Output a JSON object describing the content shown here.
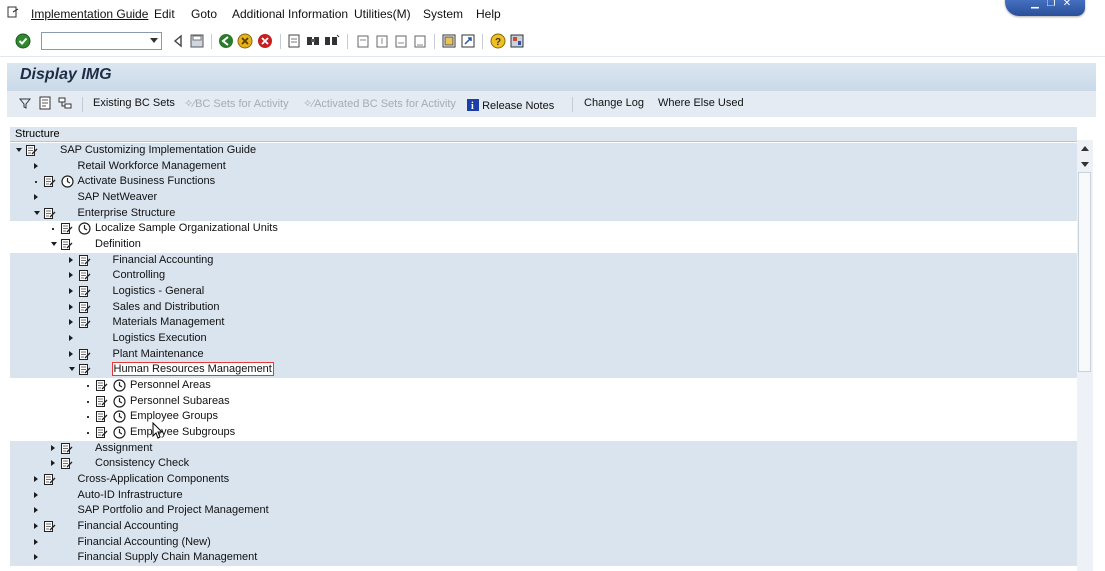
{
  "menu": {
    "items": [
      {
        "label": "Implementation Guide"
      },
      {
        "label": "Edit"
      },
      {
        "label": "Goto"
      },
      {
        "label": "Additional Information"
      },
      {
        "label": "Utilities(M)"
      },
      {
        "label": "System"
      },
      {
        "label": "Help"
      }
    ]
  },
  "toolbar": {
    "command_value": "",
    "icons": [
      "enter-icon",
      "back-triangle-icon",
      "save-icon",
      "back-icon",
      "exit-icon",
      "cancel-icon",
      "print-icon",
      "find-icon",
      "find-next-icon",
      "first-page-icon",
      "prev-page-icon",
      "next-page-icon",
      "last-page-icon",
      "new-session-icon",
      "shortcut-icon",
      "help-icon",
      "customize-layout-icon"
    ]
  },
  "title": "Display IMG",
  "app_toolbar": {
    "existing_bc_sets": "Existing BC Sets",
    "bc_sets_for_activity": "BC Sets for Activity",
    "activated_bc_sets": "Activated BC Sets for Activity",
    "release_notes": "Release Notes",
    "change_log": "Change Log",
    "where_else_used": "Where Else Used"
  },
  "tree": {
    "header": "Structure",
    "rows": [
      {
        "label": "SAP Customizing Implementation Guide",
        "level": 0,
        "expander": "open",
        "doc": true,
        "clock": false,
        "band": "a"
      },
      {
        "label": "Retail Workforce Management",
        "level": 1,
        "expander": "closed",
        "doc": false,
        "clock": false,
        "band": "a"
      },
      {
        "label": "Activate Business Functions",
        "level": 1,
        "expander": "leaf",
        "doc": true,
        "clock": true,
        "band": "a"
      },
      {
        "label": "SAP NetWeaver",
        "level": 1,
        "expander": "closed",
        "doc": false,
        "clock": false,
        "band": "a"
      },
      {
        "label": "Enterprise Structure",
        "level": 1,
        "expander": "open",
        "doc": true,
        "clock": false,
        "band": "a"
      },
      {
        "label": "Localize Sample Organizational Units",
        "level": 2,
        "expander": "leaf",
        "doc": true,
        "clock": true,
        "band": "b"
      },
      {
        "label": "Definition",
        "level": 2,
        "expander": "open",
        "doc": true,
        "clock": false,
        "band": "b"
      },
      {
        "label": "Financial Accounting",
        "level": 3,
        "expander": "closed",
        "doc": true,
        "clock": false,
        "band": "a"
      },
      {
        "label": "Controlling",
        "level": 3,
        "expander": "closed",
        "doc": true,
        "clock": false,
        "band": "a"
      },
      {
        "label": "Logistics - General",
        "level": 3,
        "expander": "closed",
        "doc": true,
        "clock": false,
        "band": "a"
      },
      {
        "label": "Sales and Distribution",
        "level": 3,
        "expander": "closed",
        "doc": true,
        "clock": false,
        "band": "a"
      },
      {
        "label": "Materials Management",
        "level": 3,
        "expander": "closed",
        "doc": true,
        "clock": false,
        "band": "a"
      },
      {
        "label": "Logistics Execution",
        "level": 3,
        "expander": "closed",
        "doc": false,
        "clock": false,
        "band": "a"
      },
      {
        "label": "Plant Maintenance",
        "level": 3,
        "expander": "closed",
        "doc": true,
        "clock": false,
        "band": "a"
      },
      {
        "label": "Human Resources Management",
        "level": 3,
        "expander": "open",
        "doc": true,
        "clock": false,
        "band": "a",
        "selected": true
      },
      {
        "label": "Personnel Areas",
        "level": 4,
        "expander": "leaf",
        "doc": true,
        "clock": true,
        "band": "b"
      },
      {
        "label": "Personnel Subareas",
        "level": 4,
        "expander": "leaf",
        "doc": true,
        "clock": true,
        "band": "b"
      },
      {
        "label": "Employee Groups",
        "level": 4,
        "expander": "leaf",
        "doc": true,
        "clock": true,
        "band": "b"
      },
      {
        "label": "Employee Subgroups",
        "level": 4,
        "expander": "leaf",
        "doc": true,
        "clock": true,
        "band": "b"
      },
      {
        "label": "Assignment",
        "level": 2,
        "expander": "closed",
        "doc": true,
        "clock": false,
        "band": "a"
      },
      {
        "label": "Consistency Check",
        "level": 2,
        "expander": "closed",
        "doc": true,
        "clock": false,
        "band": "a"
      },
      {
        "label": "Cross-Application Components",
        "level": 1,
        "expander": "closed",
        "doc": true,
        "clock": false,
        "band": "a"
      },
      {
        "label": "Auto-ID Infrastructure",
        "level": 1,
        "expander": "closed",
        "doc": false,
        "clock": false,
        "band": "a"
      },
      {
        "label": "SAP Portfolio and Project Management",
        "level": 1,
        "expander": "closed",
        "doc": false,
        "clock": false,
        "band": "a"
      },
      {
        "label": "Financial Accounting",
        "level": 1,
        "expander": "closed",
        "doc": true,
        "clock": false,
        "band": "a"
      },
      {
        "label": "Financial Accounting (New)",
        "level": 1,
        "expander": "closed",
        "doc": false,
        "clock": false,
        "band": "a"
      },
      {
        "label": "Financial Supply Chain Management",
        "level": 1,
        "expander": "closed",
        "doc": false,
        "clock": false,
        "band": "a"
      }
    ]
  }
}
